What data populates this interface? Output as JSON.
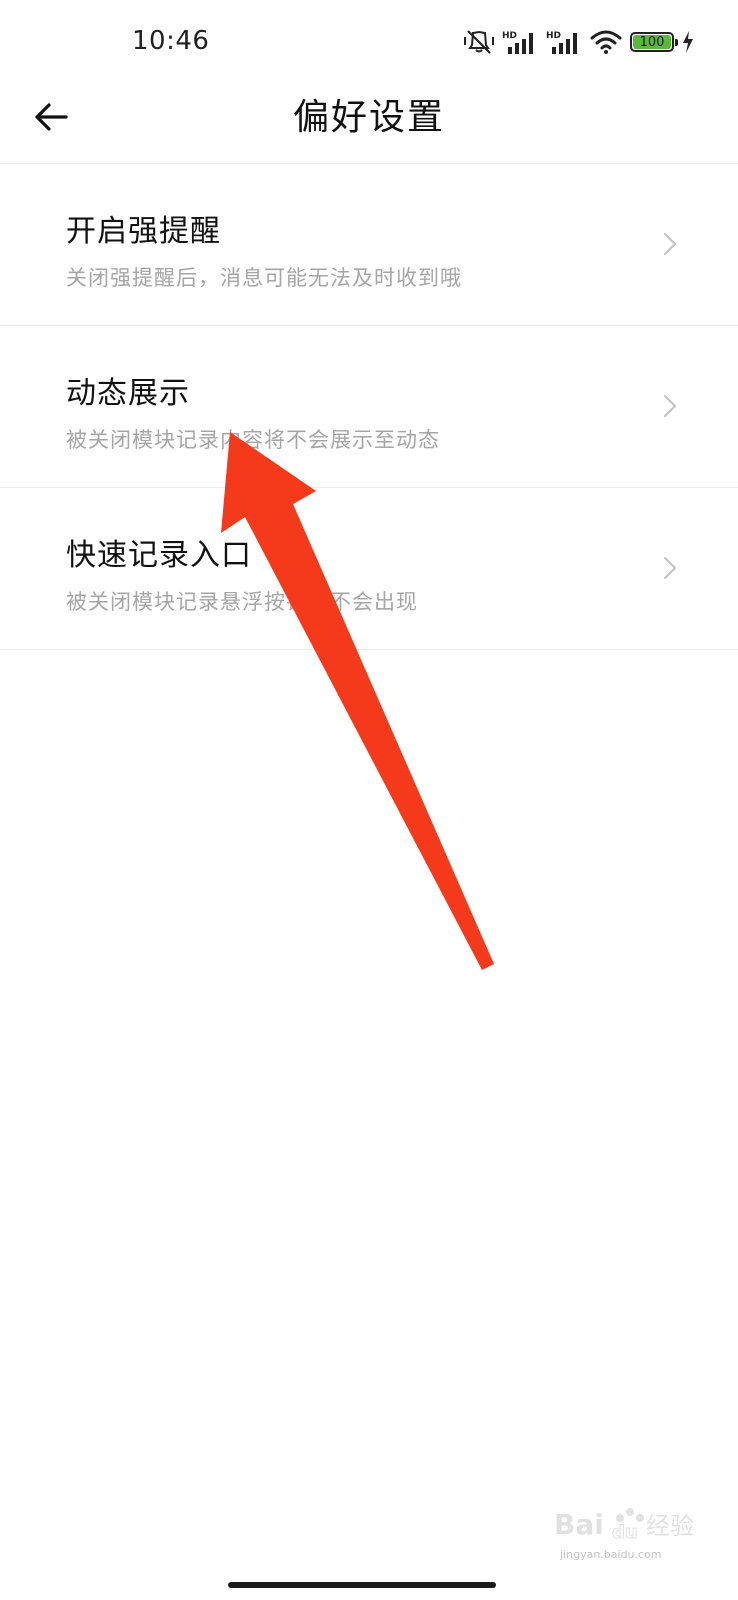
{
  "status_bar": {
    "time": "10:46",
    "battery_level": "100",
    "signal_label_1": "HD",
    "signal_label_2": "HD",
    "icons": [
      "vibrate-mute-icon",
      "signal-hd-icon",
      "signal-hd-icon",
      "wifi-icon",
      "battery-icon",
      "charging-icon"
    ],
    "battery_color": "#5ab93a"
  },
  "header": {
    "title": "偏好设置",
    "back_icon": "arrow-left-icon"
  },
  "settings": [
    {
      "title": "开启强提醒",
      "description": "关闭强提醒后，消息可能无法及时收到哦"
    },
    {
      "title": "动态展示",
      "description": "被关闭模块记录内容将不会展示至动态"
    },
    {
      "title": "快速记录入口",
      "description": "被关闭模块记录悬浮按钮将不会出现"
    }
  ],
  "annotation": {
    "type": "red-arrow",
    "color": "#f53a1c"
  },
  "watermark": {
    "text": "Bai du 经验",
    "sub": "jingyan.baidu.com"
  }
}
